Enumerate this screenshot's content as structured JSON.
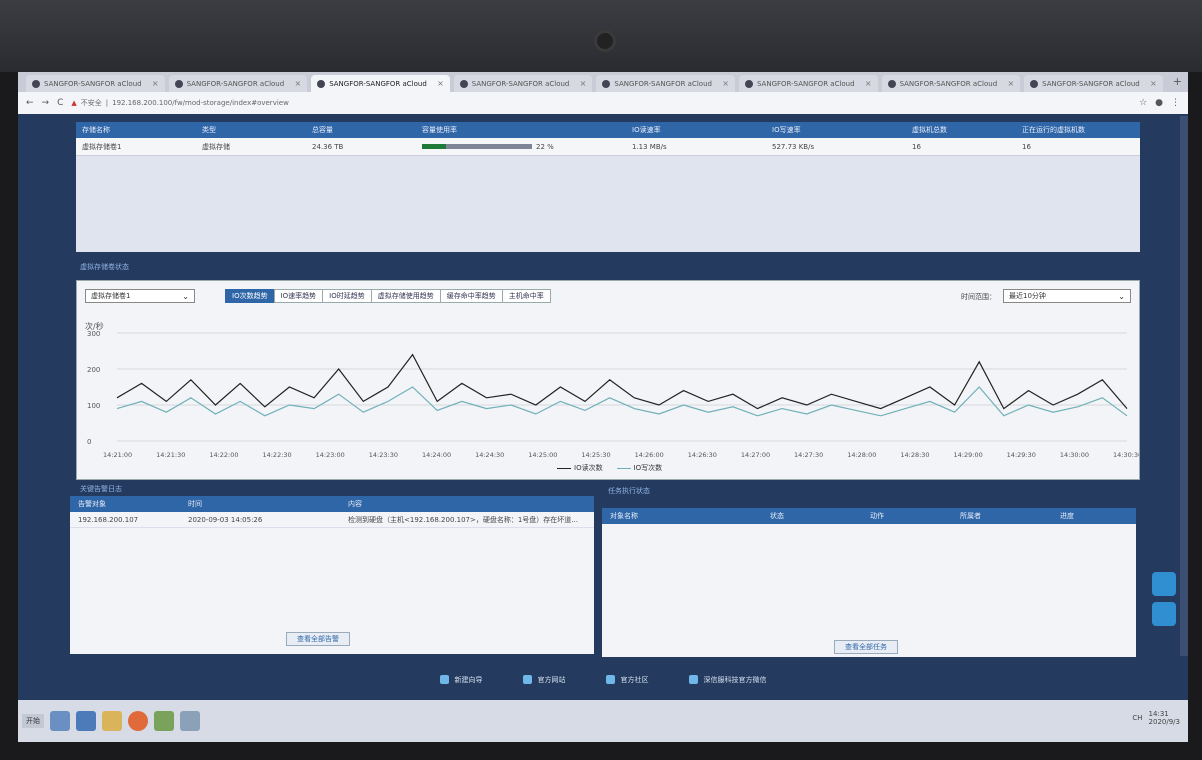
{
  "browser": {
    "tabs": [
      {
        "label": "SANGFOR-SANGFOR aCloud",
        "active": false
      },
      {
        "label": "SANGFOR-SANGFOR aCloud",
        "active": false
      },
      {
        "label": "SANGFOR-SANGFOR aCloud",
        "active": true
      },
      {
        "label": "SANGFOR-SANGFOR aCloud",
        "active": false
      },
      {
        "label": "SANGFOR-SANGFOR aCloud",
        "active": false
      },
      {
        "label": "SANGFOR-SANGFOR aCloud",
        "active": false
      },
      {
        "label": "SANGFOR-SANGFOR aCloud",
        "active": false
      },
      {
        "label": "SANGFOR-SANGFOR aCloud",
        "active": false
      }
    ],
    "newtab": "+",
    "warning": "不安全",
    "url": "192.168.200.100/fw/mod-storage/index#overview"
  },
  "storage_table": {
    "headers": [
      "存储名称",
      "类型",
      "总容量",
      "容量使用率",
      "IO读速率",
      "IO写速率",
      "虚拟机总数",
      "正在运行的虚拟机数"
    ],
    "row": {
      "name": "虚拟存储卷1",
      "type": "虚拟存储",
      "capacity": "24.36 TB",
      "usage_pct": 22,
      "usage_text": "22 %",
      "io_read": "1.13 MB/s",
      "io_write": "527.73 KB/s",
      "vm_total": "16",
      "vm_running": "16"
    }
  },
  "chart_section": {
    "title": "虚拟存储卷状态",
    "volume_select": "虚拟存储卷1",
    "tabs": [
      "IO次数趋势",
      "IO速率趋势",
      "IO时延趋势",
      "虚拟存储使用趋势",
      "缓存命中率趋势",
      "主机命中率"
    ],
    "active_tab": 0,
    "range_label": "时间范围：",
    "range_value": "最近10分钟",
    "unit": "次/秒"
  },
  "chart_data": {
    "type": "line",
    "ylim": [
      0,
      300
    ],
    "yticks": [
      "0",
      "100",
      "200",
      "300"
    ],
    "categories": [
      "14:21:00",
      "14:21:30",
      "14:22:00",
      "14:22:30",
      "14:23:00",
      "14:23:30",
      "14:24:00",
      "14:24:30",
      "14:25:00",
      "14:25:30",
      "14:26:00",
      "14:26:30",
      "14:27:00",
      "14:27:30",
      "14:28:00",
      "14:28:30",
      "14:29:00",
      "14:29:30",
      "14:30:00",
      "14:30:30"
    ],
    "series": [
      {
        "name": "IO读次数",
        "color": "#222222",
        "values": [
          120,
          160,
          110,
          170,
          100,
          160,
          95,
          150,
          120,
          200,
          110,
          150,
          240,
          110,
          160,
          120,
          130,
          100,
          150,
          110,
          170,
          120,
          100,
          140,
          110,
          130,
          90,
          120,
          100,
          130,
          110,
          90,
          120,
          150,
          100,
          220,
          90,
          140,
          100,
          130,
          170,
          90
        ]
      },
      {
        "name": "IO写次数",
        "color": "#6fb0b8",
        "values": [
          90,
          110,
          80,
          120,
          75,
          110,
          70,
          100,
          90,
          130,
          80,
          110,
          150,
          85,
          110,
          90,
          100,
          75,
          110,
          85,
          120,
          90,
          75,
          100,
          80,
          95,
          70,
          90,
          75,
          100,
          85,
          70,
          90,
          110,
          80,
          150,
          70,
          100,
          80,
          95,
          120,
          70
        ]
      }
    ]
  },
  "alert_log": {
    "title": "关键告警日志",
    "headers": [
      "告警对象",
      "时间",
      "内容"
    ],
    "rows": [
      {
        "object": "192.168.200.107",
        "time": "2020-09-03 14:05:26",
        "content": "检测到硬盘（主机<192.168.200.107>，硬盘名称：1号盘）存在坏道..."
      }
    ],
    "more": "查看全部告警"
  },
  "task_status": {
    "title": "任务执行状态",
    "headers": [
      "对象名称",
      "状态",
      "动作",
      "所属者",
      "进度"
    ],
    "more": "查看全部任务"
  },
  "footer": {
    "items": [
      "新建向导",
      "官方网站",
      "官方社区",
      "深信服科技官方微信"
    ]
  },
  "taskbar": {
    "start": "开始",
    "clock": "14:31",
    "date": "2020/9/3",
    "lang": "CH"
  }
}
